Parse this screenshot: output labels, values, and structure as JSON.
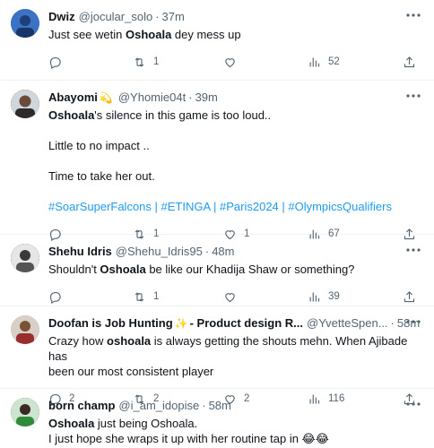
{
  "tweets": [
    {
      "name": "Dwiz",
      "emoji": "",
      "handle": "@jocular_solo",
      "time": "37m",
      "lines": [
        {
          "pre": "Just see wetin ",
          "bold": "Oshoala",
          "post": " dey mess up"
        }
      ],
      "hashtags": "",
      "replies": "",
      "retweets": "1",
      "likes": "",
      "views": "52",
      "avatar_color": "#2b5fa8"
    },
    {
      "name": "Abayomi",
      "emoji": "💫",
      "handle": "@Yhomie04t",
      "time": "39m",
      "lines": [
        {
          "pre": "",
          "bold": "Oshoala",
          "post": "'s silence in this game is too loud.."
        },
        {
          "pre": "",
          "bold": "",
          "post": ""
        },
        {
          "pre": "Little to no impact ..",
          "bold": "",
          "post": ""
        },
        {
          "pre": "",
          "bold": "",
          "post": ""
        },
        {
          "pre": "Time to take her out.",
          "bold": "",
          "post": ""
        },
        {
          "pre": "",
          "bold": "",
          "post": ""
        }
      ],
      "hashtags": "#SoarSuperFalcons | #ETINGA | #Paris2024 | #OlympicsQualifiers",
      "replies": "",
      "retweets": "1",
      "likes": "1",
      "views": "67",
      "avatar_color": "#6b4a3a"
    },
    {
      "name": "Shehu Idris",
      "emoji": "",
      "handle": "@Shehu_Idris95",
      "time": "48m",
      "lines": [
        {
          "pre": "Shouldn't ",
          "bold": "Oshoala",
          "post": " be like our Khadija Shaw or something?"
        }
      ],
      "hashtags": "",
      "replies": "",
      "retweets": "1",
      "likes": "",
      "views": "39",
      "avatar_color": "#3a3a3a"
    },
    {
      "name": "Doofan is Job Hunting",
      "emoji": "✨",
      "name_suffix": "- Product design R...",
      "handle": "@YvetteSpen...",
      "time": "58m",
      "lines": [
        {
          "pre": "Crazy how ",
          "bold": "oshoala",
          "post": " is always getting the shouts mehn.  When Ajibade has"
        },
        {
          "pre": "been our most consistent player",
          "bold": "",
          "post": ""
        }
      ],
      "hashtags": "",
      "replies": "2",
      "retweets": "2",
      "likes": "2",
      "views": "116",
      "avatar_color": "#c9a27c"
    },
    {
      "name": "born champ",
      "emoji": "",
      "handle": "@i_am_idopise",
      "time": "58m",
      "lines": [
        {
          "pre": "",
          "bold": "Oshoala",
          "post": " just being Oshoala."
        },
        {
          "pre": "I just hope she wraps it up with her routine tap in 😂😂",
          "bold": "",
          "post": ""
        }
      ],
      "hashtags": "",
      "replies": "",
      "retweets": "",
      "likes": "",
      "views": "",
      "avatar_color": "#2f7a3a"
    }
  ],
  "icons": {
    "reply": "reply-icon",
    "retweet": "retweet-icon",
    "like": "heart-icon",
    "views": "views-icon",
    "share": "share-icon",
    "more": "more-icon"
  }
}
